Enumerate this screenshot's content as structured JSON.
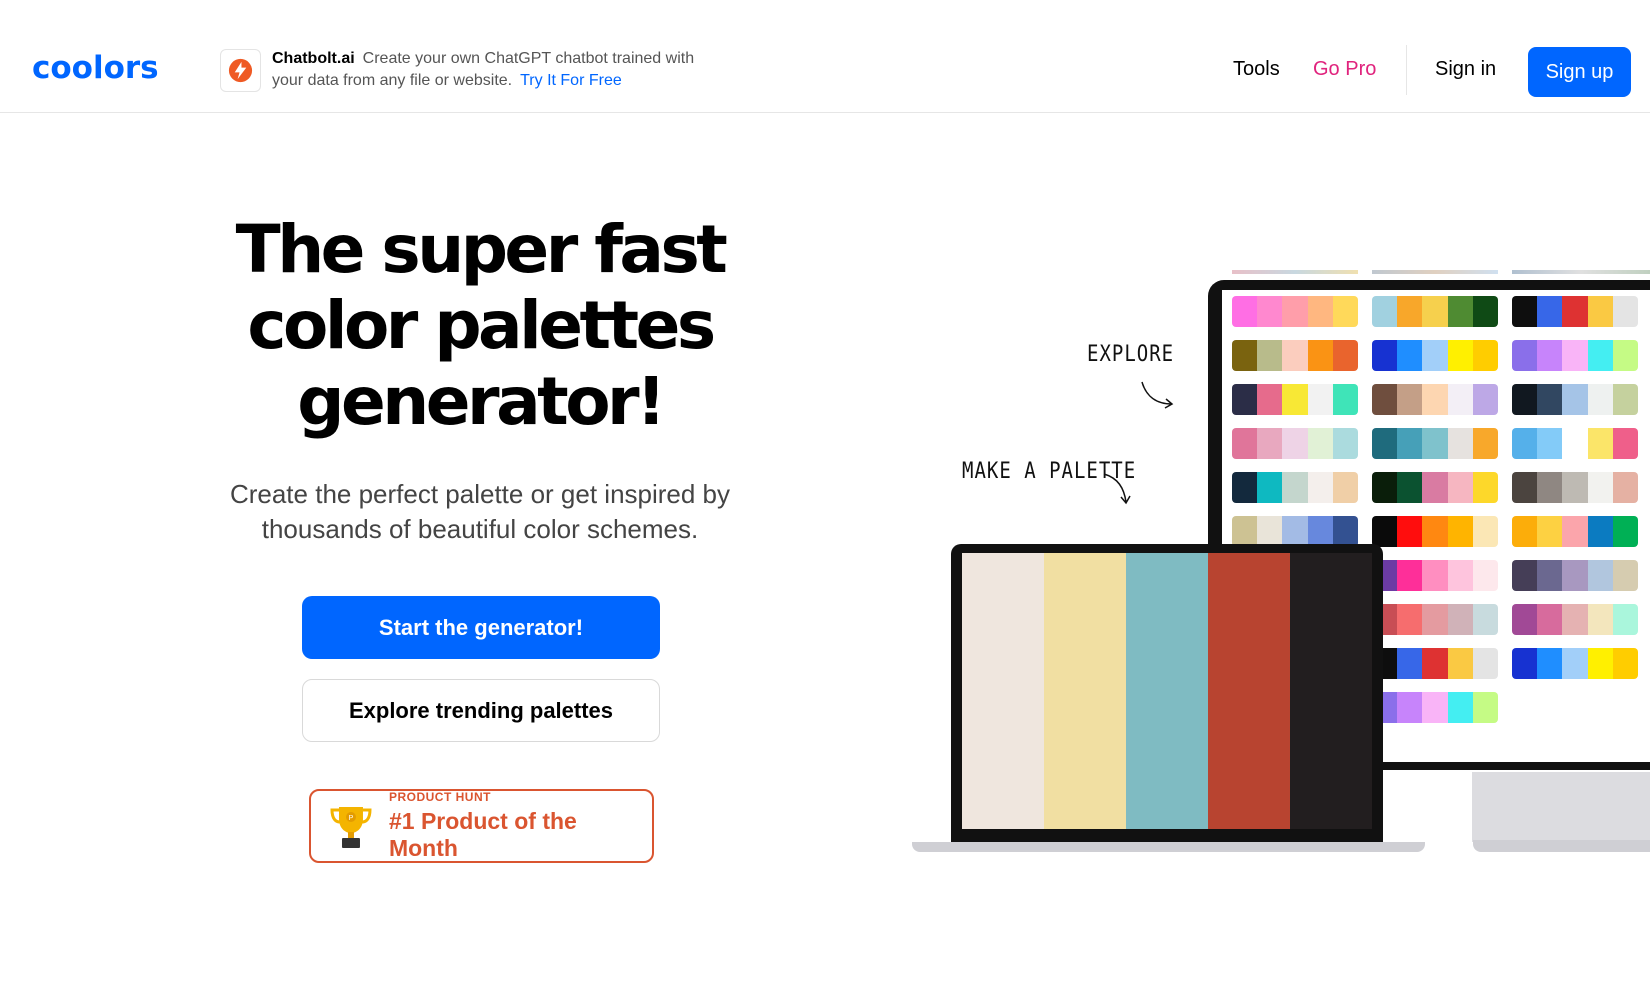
{
  "header": {
    "logo": "coolors",
    "ad": {
      "brand": "Chatbolt.ai",
      "text": "Create your own ChatGPT chatbot trained with your data from any file or website.",
      "link": "Try It For Free"
    },
    "nav": {
      "tools": "Tools",
      "go_pro": "Go Pro",
      "sign_in": "Sign in",
      "sign_up": "Sign up"
    }
  },
  "hero": {
    "title": "The super fast color palettes generator!",
    "subtitle": "Create the perfect palette or get inspired by thousands of beautiful color schemes.",
    "primary_button": "Start the generator!",
    "secondary_button": "Explore trending palettes",
    "badge_small": "PRODUCT HUNT",
    "badge_big": "#1 Product of the Month"
  },
  "illustration": {
    "label_explore": "EXPLORE",
    "label_make": "MAKE A PALETTE",
    "laptop_palette": [
      "#efe6de",
      "#f1dfa2",
      "#7fbbc2",
      "#b84430",
      "#221e1f"
    ],
    "monitor_palettes": [
      [
        "#ff6ee4",
        "#ff88cf",
        "#ff9eaa",
        "#ffb780",
        "#ffd95a"
      ],
      [
        "#a1d1e0",
        "#f8a72a",
        "#f6d04d",
        "#4f8b32",
        "#0f4a15"
      ],
      [
        "#0e0e0e",
        "#3767e8",
        "#de3232",
        "#fac943",
        "#e4e4e4"
      ],
      [
        "#7a630f",
        "#b8bb8b",
        "#fbcdbe",
        "#fa9314",
        "#e9642d"
      ],
      [
        "#1732d1",
        "#1f8eff",
        "#a2cff9",
        "#fff000",
        "#ffcd00"
      ],
      [
        "#8a6fea",
        "#c784fb",
        "#f9b4f7",
        "#44eef2",
        "#c5fb85"
      ],
      [
        "#2b2d47",
        "#e66b8c",
        "#f8e835",
        "#f2f2f2",
        "#3fe4b8"
      ],
      [
        "#6f4e3e",
        "#c49f87",
        "#fdd6b1",
        "#f3eff6",
        "#bda8e6"
      ],
      [
        "#111820",
        "#314761",
        "#a5c4e7",
        "#eef1f0",
        "#c5d19e"
      ],
      [
        "#e0759a",
        "#e8a8bf",
        "#eed3e6",
        "#e1f1d6",
        "#abdbde"
      ],
      [
        "#1f6b7d",
        "#46a0b8",
        "#7fc2cc",
        "#e6e2df",
        "#f8a82b"
      ],
      [
        "#55b0ea",
        "#83cbf8",
        "#ffffff",
        "#fbe569",
        "#ef5f8a"
      ],
      [
        "#13293d",
        "#0eb9c1",
        "#c4d6cd",
        "#f4efec",
        "#f0cfa7"
      ],
      [
        "#0a1e0a",
        "#0b5230",
        "#d97ba2",
        "#f6b6c1",
        "#fdd82a"
      ],
      [
        "#4b443f",
        "#8f8782",
        "#bebab3",
        "#f2f2ef",
        "#e5b1a3"
      ],
      [
        "#cdc293",
        "#e9e4d9",
        "#a3bbe5",
        "#6788dd",
        "#335191"
      ],
      [
        "#0a0a0a",
        "#ff0d0d",
        "#ff8811",
        "#ffb400",
        "#fbe7b5"
      ],
      [
        "#fcad0a",
        "#fdd142",
        "#fba5ab",
        "#0b7bc1",
        "#00b055"
      ],
      [
        "#2b1d63",
        "#118474",
        "#fdc90c",
        "#f1672a",
        "#f1154d"
      ],
      [
        "#6c3ba4",
        "#fe2f99",
        "#ff8ec0",
        "#fec4dd",
        "#fde8ec"
      ],
      [
        "#453e57",
        "#6b6890",
        "#a898c0",
        "#b1c6de",
        "#d6ccb0"
      ],
      [
        "#6e7681",
        "#98a0aa",
        "#dbcdb5",
        "#e5b16c",
        "#a97641"
      ],
      [
        "#c84e55",
        "#f66d6e",
        "#e49ba0",
        "#d0b2b8",
        "#c8dbde"
      ],
      [
        "#a14996",
        "#d76b9d",
        "#e5b2b2",
        "#f3e6bd",
        "#aaf6dc"
      ],
      [
        "#a1d1e0",
        "#f8a72a",
        "#f6d04d",
        "#4f8b32",
        "#0f4a15"
      ],
      [
        "#0e0e0e",
        "#3767e8",
        "#de3232",
        "#fac943",
        "#e4e4e4"
      ],
      [
        "#1732d1",
        "#1f8eff",
        "#a2cff9",
        "#fff000",
        "#ffcd00"
      ],
      [
        "#1732d1",
        "#1f8eff",
        "#a2cff9",
        "#fff000",
        "#ffcd00"
      ],
      [
        "#8a6fea",
        "#c784fb",
        "#f9b4f7",
        "#44eef2",
        "#c5fb85"
      ]
    ]
  },
  "colors": {
    "brand_blue": "#0066ff",
    "go_pro_pink": "#e0237d",
    "product_hunt_orange": "#da5530"
  }
}
